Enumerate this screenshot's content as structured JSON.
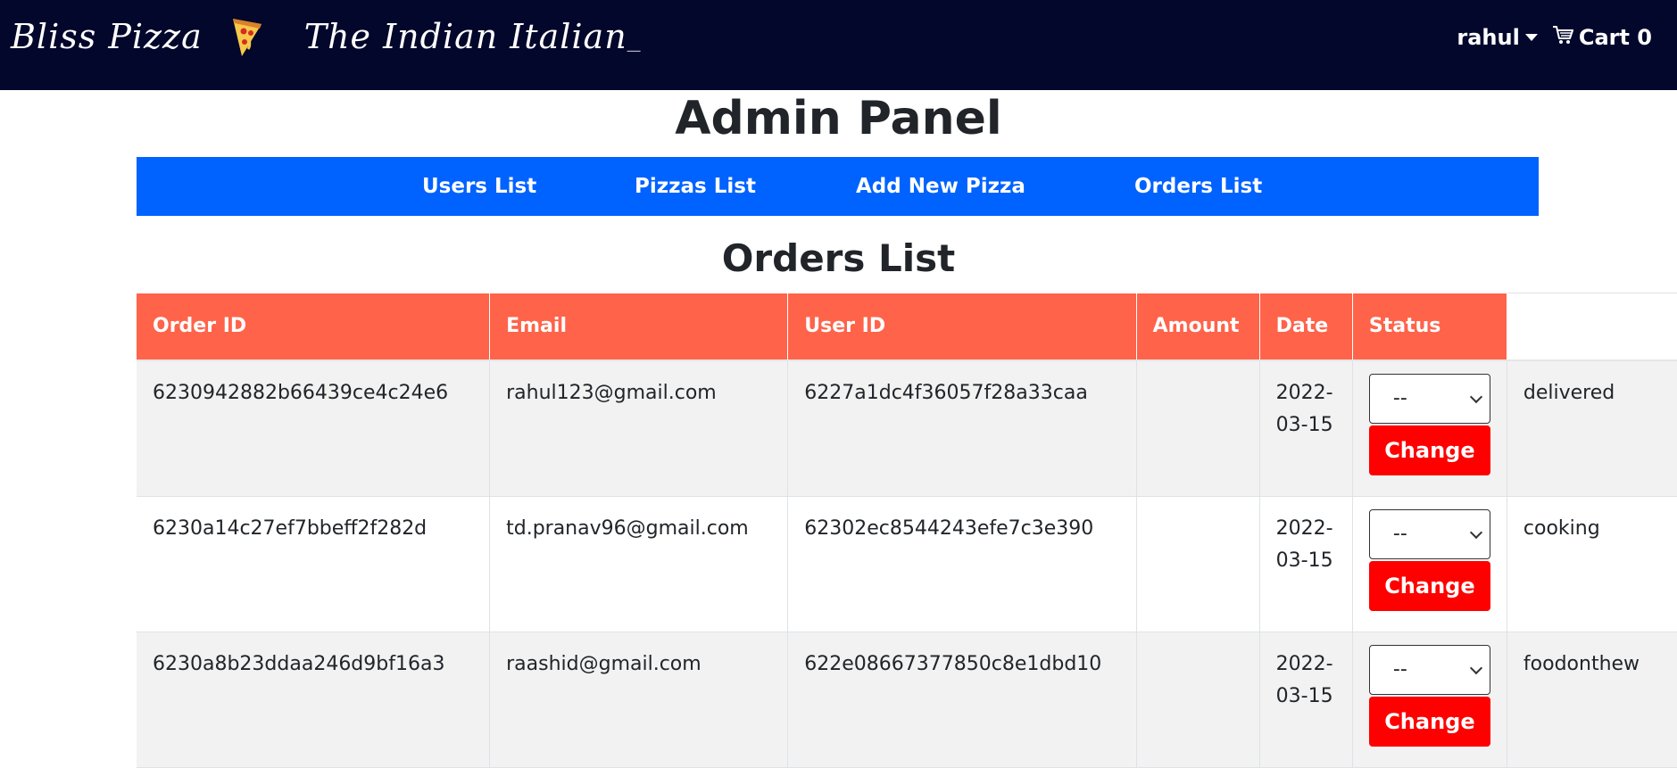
{
  "navbar": {
    "brand": "Bliss Pizza",
    "tagline": "The Indian Italian",
    "user": "rahul",
    "cart_label": "Cart 0"
  },
  "page_title": "Admin Panel",
  "admin_nav": [
    "Users List",
    "Pizzas List",
    "Add New Pizza",
    "Orders List"
  ],
  "section_title": "Orders List",
  "table": {
    "headers": [
      "Order ID",
      "Email",
      "User ID",
      "Amount",
      "Date",
      "Status"
    ],
    "rows": [
      {
        "order_id": "6230942882b66439ce4c24e6",
        "email": "rahul123@gmail.com",
        "user_id": "6227a1dc4f36057f28a33caa",
        "amount": "",
        "date": "2022-03-15",
        "select_value": "--",
        "button": "Change",
        "status": "delivered"
      },
      {
        "order_id": "6230a14c27ef7bbeff2f282d",
        "email": "td.pranav96@gmail.com",
        "user_id": "62302ec8544243efe7c3e390",
        "amount": "",
        "date": "2022-03-15",
        "select_value": "--",
        "button": "Change",
        "status": "cooking"
      },
      {
        "order_id": "6230a8b23ddaa246d9bf16a3",
        "email": "raashid@gmail.com",
        "user_id": "622e08667377850c8e1dbd10",
        "amount": "",
        "date": "2022-03-15",
        "select_value": "--",
        "button": "Change",
        "status": "foodonthew"
      }
    ]
  },
  "colors": {
    "navbar": "#03072c",
    "admin_nav": "#0062ff",
    "table_header": "#ff634a",
    "change_button": "#ff0000"
  }
}
